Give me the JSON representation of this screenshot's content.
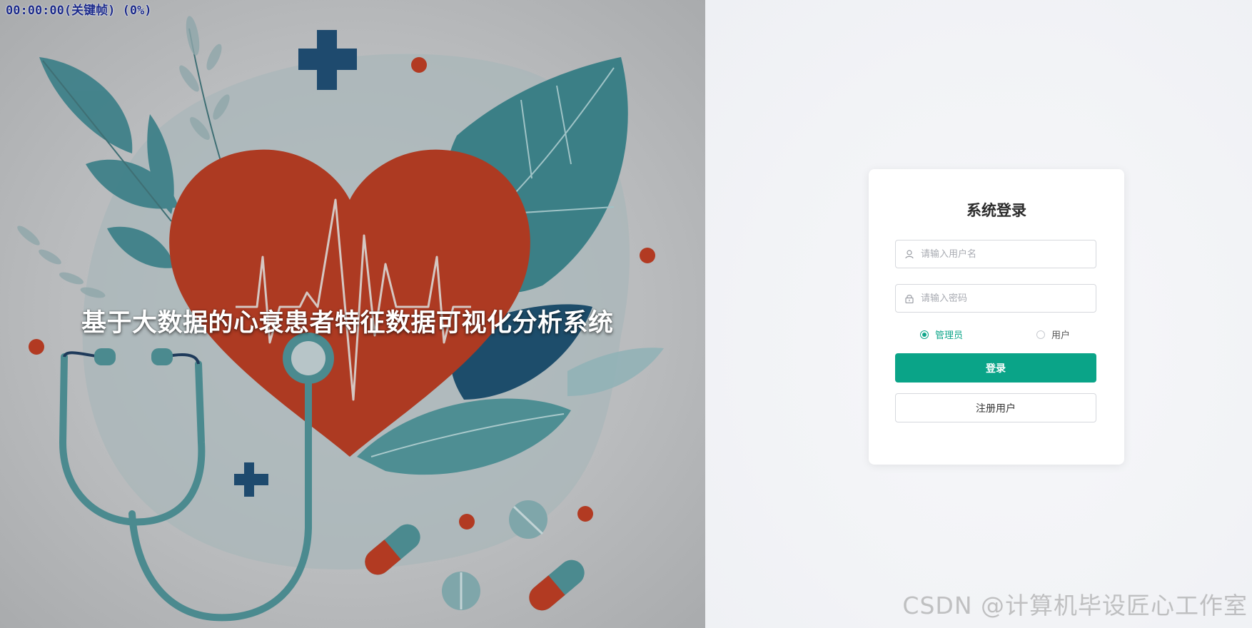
{
  "timecode": "00:00:00(关键帧) (0%)",
  "left_panel": {
    "system_title": "基于大数据的心衰患者特征数据可视化分析系统"
  },
  "login": {
    "title": "系统登录",
    "username_placeholder": "请输入用户名",
    "password_placeholder": "请输入密码",
    "roles": [
      {
        "label": "管理员",
        "selected": true
      },
      {
        "label": "用户",
        "selected": false
      }
    ],
    "login_button": "登录",
    "register_button": "注册用户"
  },
  "watermark": "CSDN @计算机毕设匠心工作室",
  "colors": {
    "accent": "#0aa488",
    "heart": "#b23a22",
    "leaf": "#3d8489",
    "navy": "#1e4a6e"
  },
  "icons": {
    "username": "user-icon",
    "password": "lock-icon"
  }
}
